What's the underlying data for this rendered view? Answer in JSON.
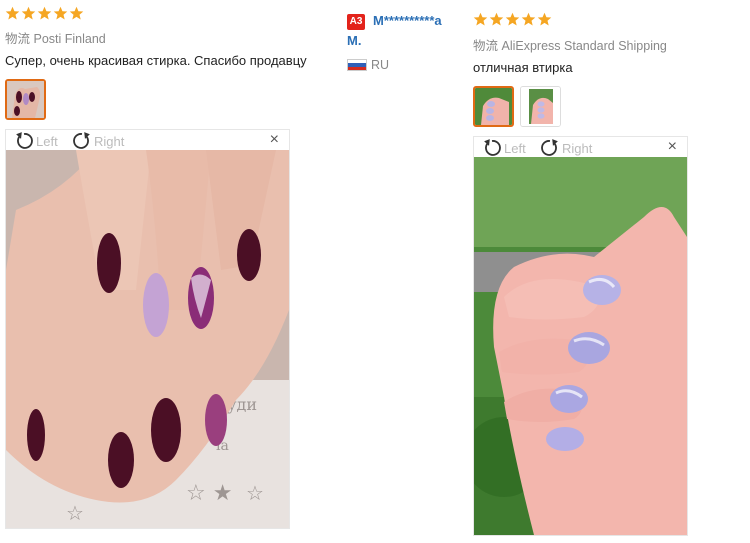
{
  "review1": {
    "stars": 5,
    "shipping_cn": "物流",
    "shipping_method": "Posti Finland",
    "text": "Супер, очень красивая стирка. Спасибо продавцу",
    "viewer": {
      "left_label": "Left",
      "right_label": "Right",
      "close": "×"
    }
  },
  "reviewer": {
    "badge": "A3",
    "name_line1": "M**********a",
    "name_line2": "M.",
    "country": "RU"
  },
  "review2": {
    "stars": 5,
    "shipping_cn": "物流",
    "shipping_method": "AliExpress Standard Shipping",
    "text": "отличная втирка",
    "viewer": {
      "left_label": "Left",
      "right_label": "Right",
      "close": "×"
    }
  },
  "colors": {
    "star": "#f5a623",
    "accent": "#e06a14",
    "link": "#2b6fb5",
    "badge": "#e3231b"
  }
}
